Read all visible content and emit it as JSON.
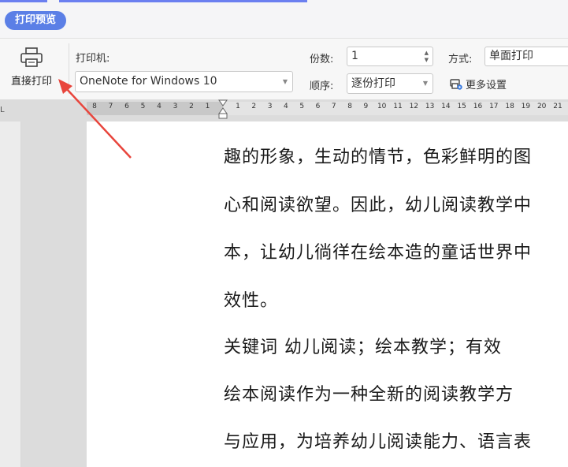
{
  "tab": {
    "label": "打印预览"
  },
  "toolbar": {
    "direct_print_label": "直接打印",
    "printer_label": "打印机:",
    "printer_value": "OneNote for Windows 10",
    "copies_label": "份数:",
    "copies_value": "1",
    "order_label": "顺序:",
    "order_value": "逐份打印",
    "mode_label": "方式:",
    "mode_value": "单面打印",
    "more_settings_label": "更多设置"
  },
  "ruler": {
    "left_numbers": [
      "8",
      "7",
      "6",
      "5",
      "4",
      "3",
      "2",
      "1"
    ],
    "right_numbers": [
      "1",
      "2",
      "3",
      "4",
      "5",
      "6",
      "7",
      "8",
      "9",
      "10",
      "11",
      "12",
      "13",
      "14",
      "15",
      "16",
      "17",
      "18",
      "19",
      "20",
      "21"
    ]
  },
  "document": {
    "lines": [
      "趣的形象，生动的情节，色彩鲜明的图",
      "心和阅读欲望。因此，幼儿阅读教学中",
      "本，让幼儿徜徉在绘本造的童话世界中",
      "效性。",
      "关键词    幼儿阅读；绘本教学；有效",
      "绘本阅读作为一种全新的阅读教学方",
      "与应用，为培养幼儿阅读能力、语言表"
    ]
  },
  "colors": {
    "accent": "#5b7fe6",
    "annotation_arrow": "#e8453c"
  },
  "icons": [
    "printer-icon",
    "more-settings-icon",
    "dropdown-arrow-icon"
  ]
}
